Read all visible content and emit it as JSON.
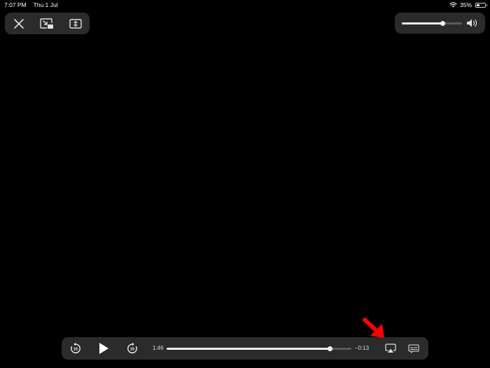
{
  "status_bar": {
    "time": "7:07 PM",
    "date": "Thu 1 Jul",
    "battery": "35%",
    "battery_level": 0.35
  },
  "top_controls": {
    "icons": [
      "close-icon",
      "picture-in-picture-icon",
      "aspect-ratio-icon"
    ]
  },
  "volume": {
    "level": 0.68,
    "icon": "speaker-icon"
  },
  "player": {
    "elapsed": "1:46",
    "remaining": "–0:13",
    "progress": 0.886,
    "skip_back_label": "15",
    "skip_forward_label": "15",
    "icons": [
      "skip-back-15-icon",
      "play-icon",
      "skip-forward-15-icon",
      "airplay-icon",
      "subtitles-icon"
    ]
  },
  "annotation": {
    "color": "#ff0000",
    "icon": "red-arrow-icon"
  }
}
